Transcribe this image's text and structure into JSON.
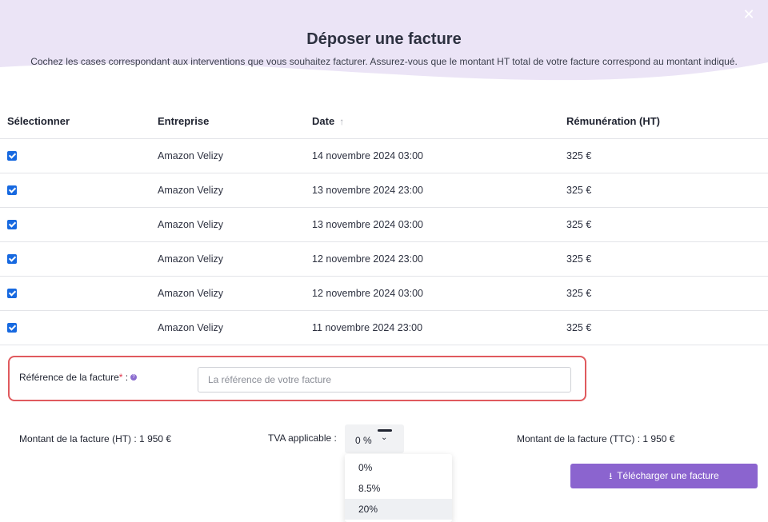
{
  "modal": {
    "close_icon": "close-icon",
    "title": "Déposer une facture",
    "subtitle": "Cochez les cases correspondant aux interventions que vous souhaitez facturer. Assurez-vous que le montant HT total de votre facture correspond au montant indiqué.",
    "header_color": "#ebe4f6"
  },
  "table": {
    "headers": {
      "select": "Sélectionner",
      "company": "Entreprise",
      "date": "Date",
      "date_sort_icon": "arrow-up-icon",
      "pay": "Rémunération (HT)"
    },
    "rows": [
      {
        "checked": true,
        "company": "Amazon Velizy",
        "date": "14 novembre 2024 03:00",
        "pay": "325 €"
      },
      {
        "checked": true,
        "company": "Amazon Velizy",
        "date": "13 novembre 2024 23:00",
        "pay": "325 €"
      },
      {
        "checked": true,
        "company": "Amazon Velizy",
        "date": "13 novembre 2024 03:00",
        "pay": "325 €"
      },
      {
        "checked": true,
        "company": "Amazon Velizy",
        "date": "12 novembre 2024 23:00",
        "pay": "325 €"
      },
      {
        "checked": true,
        "company": "Amazon Velizy",
        "date": "12 novembre 2024 03:00",
        "pay": "325 €"
      },
      {
        "checked": true,
        "company": "Amazon Velizy",
        "date": "11 novembre 2024 23:00",
        "pay": "325 €"
      }
    ]
  },
  "reference": {
    "label": "Référence de la facture",
    "required_mark": "*",
    "colon": " :",
    "help_icon": "question-icon",
    "placeholder": "La référence de votre facture",
    "value": "",
    "highlight_color": "#e05a5e"
  },
  "totals": {
    "ht": "Montant de la facture (HT) : 1 950 €",
    "tva_label": "TVA applicable :",
    "tva_value": "0 %",
    "ttc": "Montant de la facture (TTC) : 1 950 €"
  },
  "tva_options": [
    "0%",
    "8.5%",
    "20%"
  ],
  "tva_highlighted_option": "20%",
  "upload_button": {
    "label": "Télécharger une facture",
    "icon": "download-icon",
    "color": "#8b64cf"
  }
}
